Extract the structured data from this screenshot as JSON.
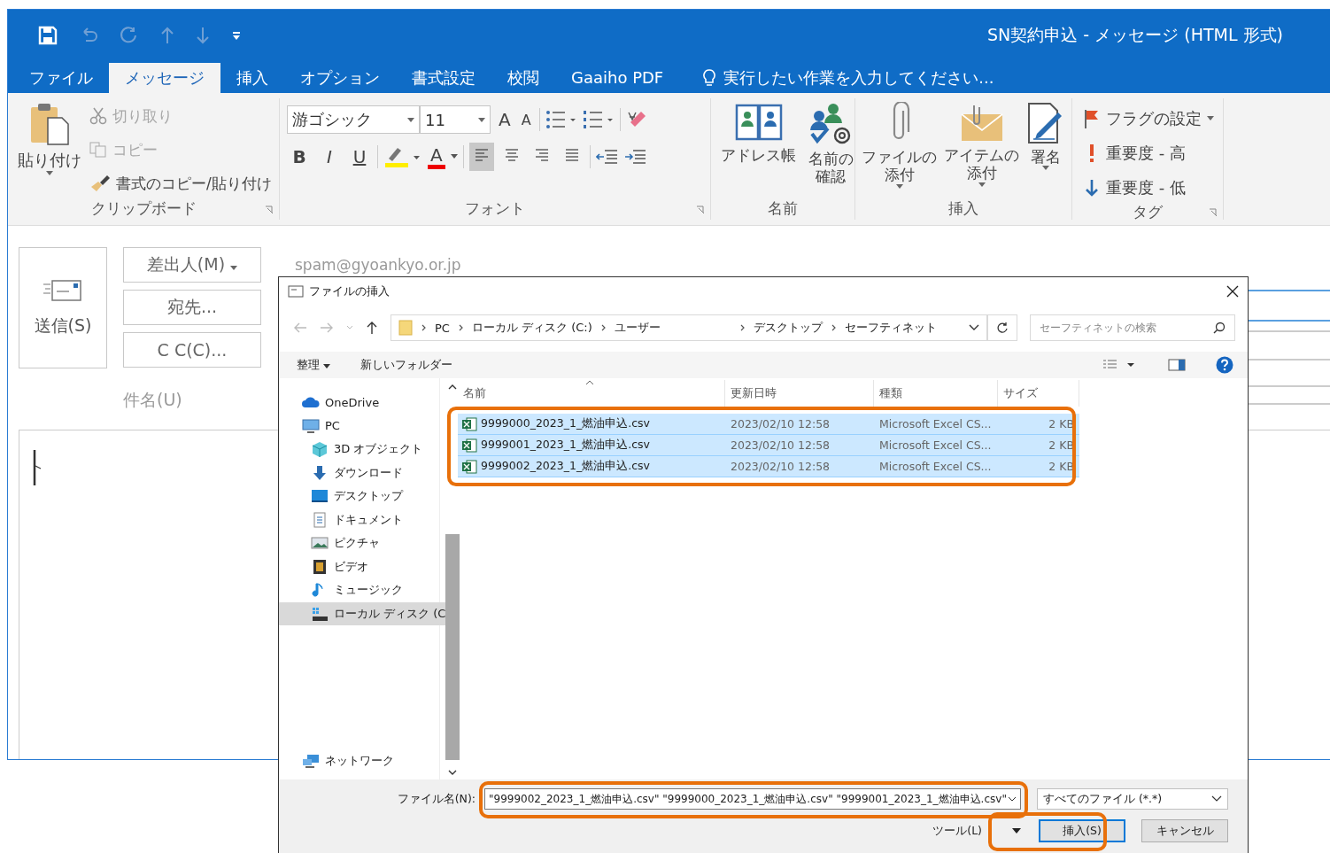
{
  "window": {
    "title": "SN契約申込 - メッセージ (HTML 形式)"
  },
  "tabs": [
    {
      "label": "ファイル",
      "selected": false
    },
    {
      "label": "メッセージ",
      "selected": true
    },
    {
      "label": "挿入",
      "selected": false
    },
    {
      "label": "オプション",
      "selected": false
    },
    {
      "label": "書式設定",
      "selected": false
    },
    {
      "label": "校閲",
      "selected": false
    },
    {
      "label": "Gaaiho PDF",
      "selected": false
    }
  ],
  "tell_me": {
    "placeholder": "実行したい作業を入力してください..."
  },
  "clipboard": {
    "paste": "貼り付け",
    "cut": {
      "label": "切り取り",
      "disabled": true
    },
    "copy": {
      "label": "コピー",
      "disabled": true
    },
    "format_painter": {
      "label": "書式のコピー/貼り付け",
      "disabled": false
    },
    "group_label": "クリップボード"
  },
  "font": {
    "font_name": "游ゴシック",
    "font_size": "11",
    "grow": "A",
    "shrink": "A",
    "bold": "B",
    "italic": "I",
    "underline": "U",
    "font_color": "A",
    "group_label": "フォント",
    "align": [
      {
        "kind": "left",
        "selected": true
      },
      {
        "kind": "center",
        "selected": false
      },
      {
        "kind": "right",
        "selected": false
      },
      {
        "kind": "justify",
        "selected": false
      }
    ]
  },
  "names": {
    "address_book": "アドレス帳",
    "check_names": [
      "名前の",
      "確認"
    ],
    "group_label": "名前"
  },
  "insert": {
    "attach_file": [
      "ファイルの",
      "添付"
    ],
    "attach_item": [
      "アイテムの",
      "添付"
    ],
    "signature": "署名",
    "group_label": "挿入"
  },
  "tags": {
    "flag": "フラグの設定",
    "high": "重要度 - 高",
    "low": "重要度 - 低",
    "group_label": "タグ"
  },
  "compose": {
    "send": "送信(S)",
    "from": "差出人(M)",
    "to": "宛先...",
    "cc": "C C(C)...",
    "subject_label": "件名(U)",
    "from_address": "spam@gyoankyo.or.jp"
  },
  "dialog": {
    "title": "ファイルの挿入",
    "breadcrumb": [
      "PC",
      "ローカル ディスク (C:)",
      "ユーザー",
      "デスクトップ",
      "セーフティネット"
    ],
    "search": {
      "placeholder": "セーフティネットの検索"
    },
    "organize": "整理",
    "new_folder": "新しいフォルダー",
    "nav": [
      {
        "label": "OneDrive",
        "kind": "cloud",
        "selected": false
      },
      {
        "label": "PC",
        "kind": "pc",
        "selected": false,
        "children": [
          {
            "label": "3D オブジェクト",
            "kind": "cube",
            "selected": false
          },
          {
            "label": "ダウンロード",
            "kind": "download",
            "selected": false
          },
          {
            "label": "デスクトップ",
            "kind": "desktop",
            "selected": false
          },
          {
            "label": "ドキュメント",
            "kind": "document",
            "selected": false
          },
          {
            "label": "ピクチャ",
            "kind": "pictures",
            "selected": false
          },
          {
            "label": "ビデオ",
            "kind": "video",
            "selected": false
          },
          {
            "label": "ミュージック",
            "kind": "music",
            "selected": false
          },
          {
            "label": "ローカル ディスク (C",
            "kind": "drive",
            "selected": true
          }
        ]
      },
      {
        "label": "ネットワーク",
        "kind": "network",
        "selected": false
      }
    ],
    "columns": [
      "名前",
      "更新日時",
      "種類",
      "サイズ"
    ],
    "files": [
      {
        "name": "9999000_2023_1_燃油申込.csv",
        "modified": "2023/02/10 12:58",
        "type": "Microsoft Excel CS...",
        "size": "2 KB",
        "selected": true
      },
      {
        "name": "9999001_2023_1_燃油申込.csv",
        "modified": "2023/02/10 12:58",
        "type": "Microsoft Excel CS...",
        "size": "2 KB",
        "selected": true
      },
      {
        "name": "9999002_2023_1_燃油申込.csv",
        "modified": "2023/02/10 12:58",
        "type": "Microsoft Excel CS...",
        "size": "2 KB",
        "selected": true
      }
    ],
    "filename_label": "ファイル名(N):",
    "filename_value": "\"9999002_2023_1_燃油申込.csv\" \"9999000_2023_1_燃油申込.csv\" \"9999001_2023_1_燃油申込.csv\"",
    "filetype": "すべてのファイル (*.*)",
    "tools": "ツール(L)",
    "insert_button": "挿入(S)",
    "cancel_button": "キャンセル"
  }
}
